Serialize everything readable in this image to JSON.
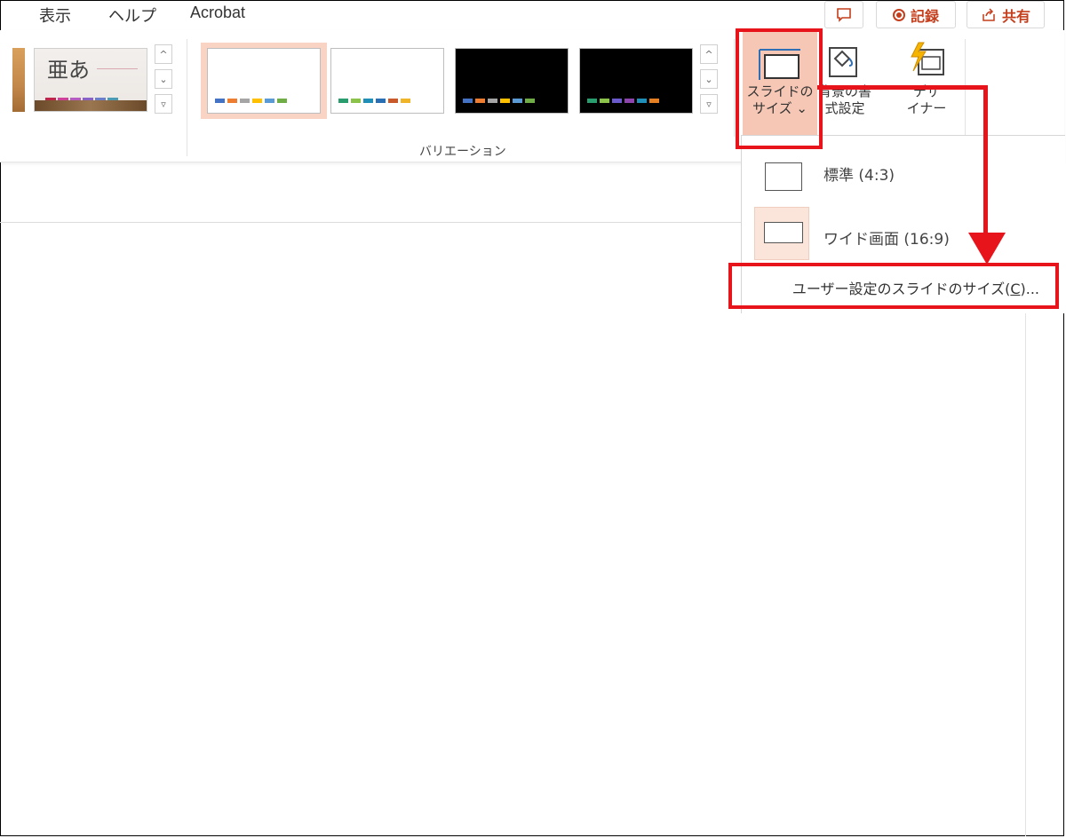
{
  "menu": {
    "view": "表示",
    "help": "ヘルプ",
    "acrobat": "Acrobat"
  },
  "top_buttons": {
    "record": "記録",
    "share": "共有"
  },
  "themes": {
    "thumb_text": "亜あ"
  },
  "variations": {
    "group_label": "バリエーション"
  },
  "design_tools": {
    "slide_size_line1": "スライドの",
    "slide_size_line2": "サイズ ⌄",
    "bg_format_line1": "背景の書",
    "bg_format_line2": "式設定",
    "designer_line1": "デザ",
    "designer_line2": "イナー"
  },
  "slide_size_menu": {
    "standard": "標準 (4:3)",
    "widescreen": "ワイド画面 (16:9)",
    "custom_prefix": "ユーザー設定のスライドのサイズ(",
    "custom_accel": "C",
    "custom_suffix": ")..."
  },
  "colors": {
    "accent": "#c43e1c",
    "annotation_red": "#e8141c",
    "selected_bg": "#f6c7b4"
  }
}
